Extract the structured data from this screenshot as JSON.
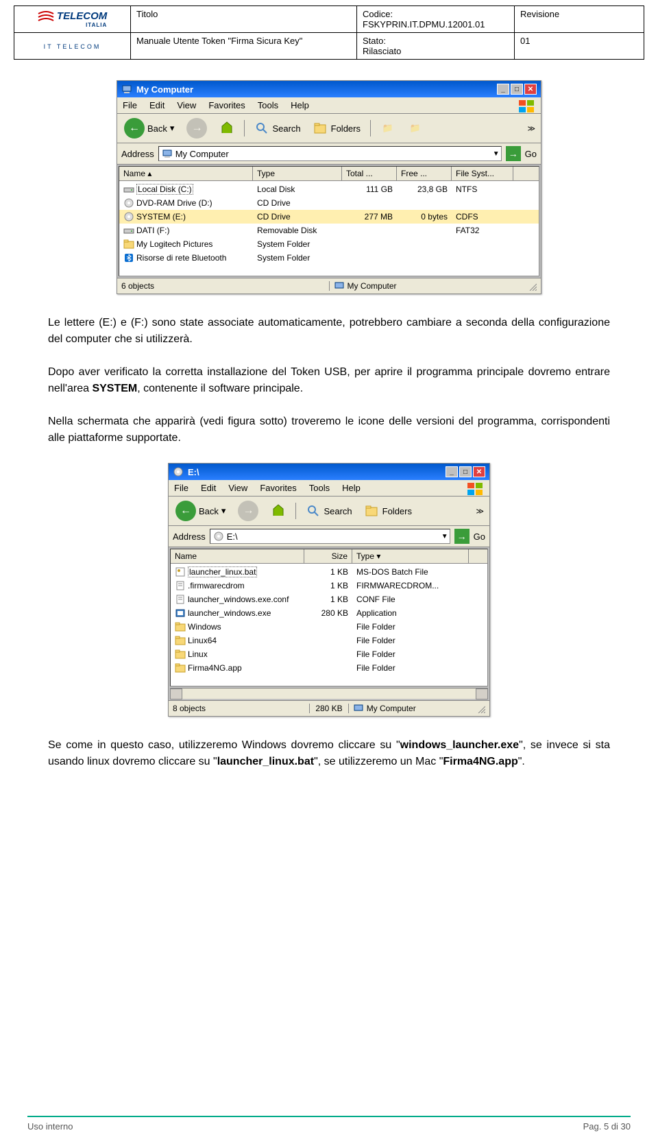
{
  "header": {
    "titolo_label": "Titolo",
    "manuale": "Manuale Utente Token \"Firma Sicura Key\"",
    "codice_label": "Codice:",
    "codice": "FSKYPRIN.IT.DPMU.12001.01",
    "stato_label": "Stato:",
    "stato": "Rilasciato",
    "revisione_label": "Revisione",
    "revisione": "01",
    "logo_main": "TELECOM",
    "logo_sub": "ITALIA",
    "logo_it": "IT TELECOM"
  },
  "win1": {
    "title": "My Computer",
    "menu": [
      "File",
      "Edit",
      "View",
      "Favorites",
      "Tools",
      "Help"
    ],
    "toolbar": {
      "back": "Back",
      "search": "Search",
      "folders": "Folders"
    },
    "address_label": "Address",
    "address_value": "My Computer",
    "go_label": "Go",
    "columns": {
      "name": "Name",
      "type": "Type",
      "total": "Total ...",
      "free": "Free ...",
      "fs": "File Syst..."
    },
    "rows": [
      {
        "name": "Local Disk (C:)",
        "type": "Local Disk",
        "total": "111 GB",
        "free": "23,8 GB",
        "fs": "NTFS",
        "icon": "hdd",
        "sel": true
      },
      {
        "name": "DVD-RAM Drive (D:)",
        "type": "CD Drive",
        "total": "",
        "free": "",
        "fs": "",
        "icon": "cd"
      },
      {
        "name": "SYSTEM (E:)",
        "type": "CD Drive",
        "total": "277 MB",
        "free": "0 bytes",
        "fs": "CDFS",
        "icon": "cd",
        "hl": true
      },
      {
        "name": "DATI (F:)",
        "type": "Removable Disk",
        "total": "",
        "free": "",
        "fs": "FAT32",
        "icon": "hdd"
      },
      {
        "name": "My Logitech Pictures",
        "type": "System Folder",
        "total": "",
        "free": "",
        "fs": "",
        "icon": "folder"
      },
      {
        "name": "Risorse di rete Bluetooth",
        "type": "System Folder",
        "total": "",
        "free": "",
        "fs": "",
        "icon": "bt"
      }
    ],
    "status_objects": "6 objects",
    "status_location": "My Computer"
  },
  "para1": "Le lettere (E:) e (F:) sono state associate automaticamente, potrebbero cambiare a seconda della configurazione del computer che si utilizzerà.",
  "para2_a": "Dopo aver verificato la corretta installazione del Token USB, per aprire il programma principale dovremo entrare nell'area ",
  "para2_b": "SYSTEM",
  "para2_c": ", contenente il software principale.",
  "para3": "Nella schermata che apparirà (vedi figura sotto) troveremo le icone delle versioni del programma, corrispondenti alle piattaforme supportate.",
  "win2": {
    "title": "E:\\",
    "menu": [
      "File",
      "Edit",
      "View",
      "Favorites",
      "Tools",
      "Help"
    ],
    "toolbar": {
      "back": "Back",
      "search": "Search",
      "folders": "Folders"
    },
    "address_label": "Address",
    "address_value": "E:\\",
    "go_label": "Go",
    "columns": {
      "name": "Name",
      "size": "Size",
      "type": "Type"
    },
    "rows": [
      {
        "name": "launcher_linux.bat",
        "size": "1 KB",
        "type": "MS-DOS Batch File",
        "icon": "bat",
        "sel": true
      },
      {
        "name": ".firmwarecdrom",
        "size": "1 KB",
        "type": "FIRMWARECDROM...",
        "icon": "file"
      },
      {
        "name": "launcher_windows.exe.conf",
        "size": "1 KB",
        "type": "CONF File",
        "icon": "file"
      },
      {
        "name": "launcher_windows.exe",
        "size": "280 KB",
        "type": "Application",
        "icon": "exe"
      },
      {
        "name": "Windows",
        "size": "",
        "type": "File Folder",
        "icon": "folder"
      },
      {
        "name": "Linux64",
        "size": "",
        "type": "File Folder",
        "icon": "folder"
      },
      {
        "name": "Linux",
        "size": "",
        "type": "File Folder",
        "icon": "folder"
      },
      {
        "name": "Firma4NG.app",
        "size": "",
        "type": "File Folder",
        "icon": "folder"
      }
    ],
    "status_objects": "8 objects",
    "status_size": "280 KB",
    "status_location": "My Computer"
  },
  "para4_a": "Se come in questo caso, utilizzeremo Windows dovremo cliccare su \"",
  "para4_b": "windows_launcher.exe",
  "para4_c": "\", se invece si sta usando linux dovremo cliccare su \"",
  "para4_d": "launcher_linux.bat",
  "para4_e": "\", se utilizzeremo un Mac \"",
  "para4_f": "Firma4NG.app",
  "para4_g": "\".",
  "footer": {
    "left": "Uso interno",
    "right": "Pag. 5 di 30"
  }
}
